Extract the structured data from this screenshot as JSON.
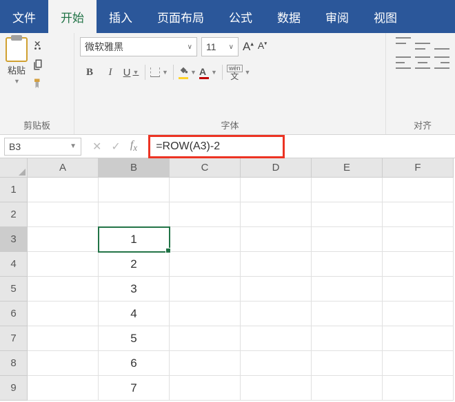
{
  "tabs": {
    "file": "文件",
    "home": "开始",
    "insert": "插入",
    "layout": "页面布局",
    "formulas": "公式",
    "data": "数据",
    "review": "审阅",
    "view": "视图"
  },
  "ribbon": {
    "clipboard": {
      "paste": "粘贴",
      "label": "剪贴板"
    },
    "font": {
      "name": "微软雅黑",
      "size": "11",
      "label": "字体",
      "bold": "B",
      "italic": "I",
      "underline": "U",
      "fontcolor_letter": "A",
      "wen": "wén",
      "wenchar": "文"
    },
    "align": {
      "label": "对齐"
    }
  },
  "namebox": "B3",
  "formula": "=ROW(A3)-2",
  "columns": [
    "A",
    "B",
    "C",
    "D",
    "E",
    "F"
  ],
  "rows": [
    "1",
    "2",
    "3",
    "4",
    "5",
    "6",
    "7",
    "8",
    "9"
  ],
  "selected_row": "3",
  "selected_col": "B",
  "cells": {
    "B3": "1",
    "B4": "2",
    "B5": "3",
    "B6": "4",
    "B7": "5",
    "B8": "6",
    "B9": "7"
  },
  "colors": {
    "fontcolor": "#c00000",
    "fillcolor": "#ffd32a",
    "highlight": "#ec3323"
  }
}
